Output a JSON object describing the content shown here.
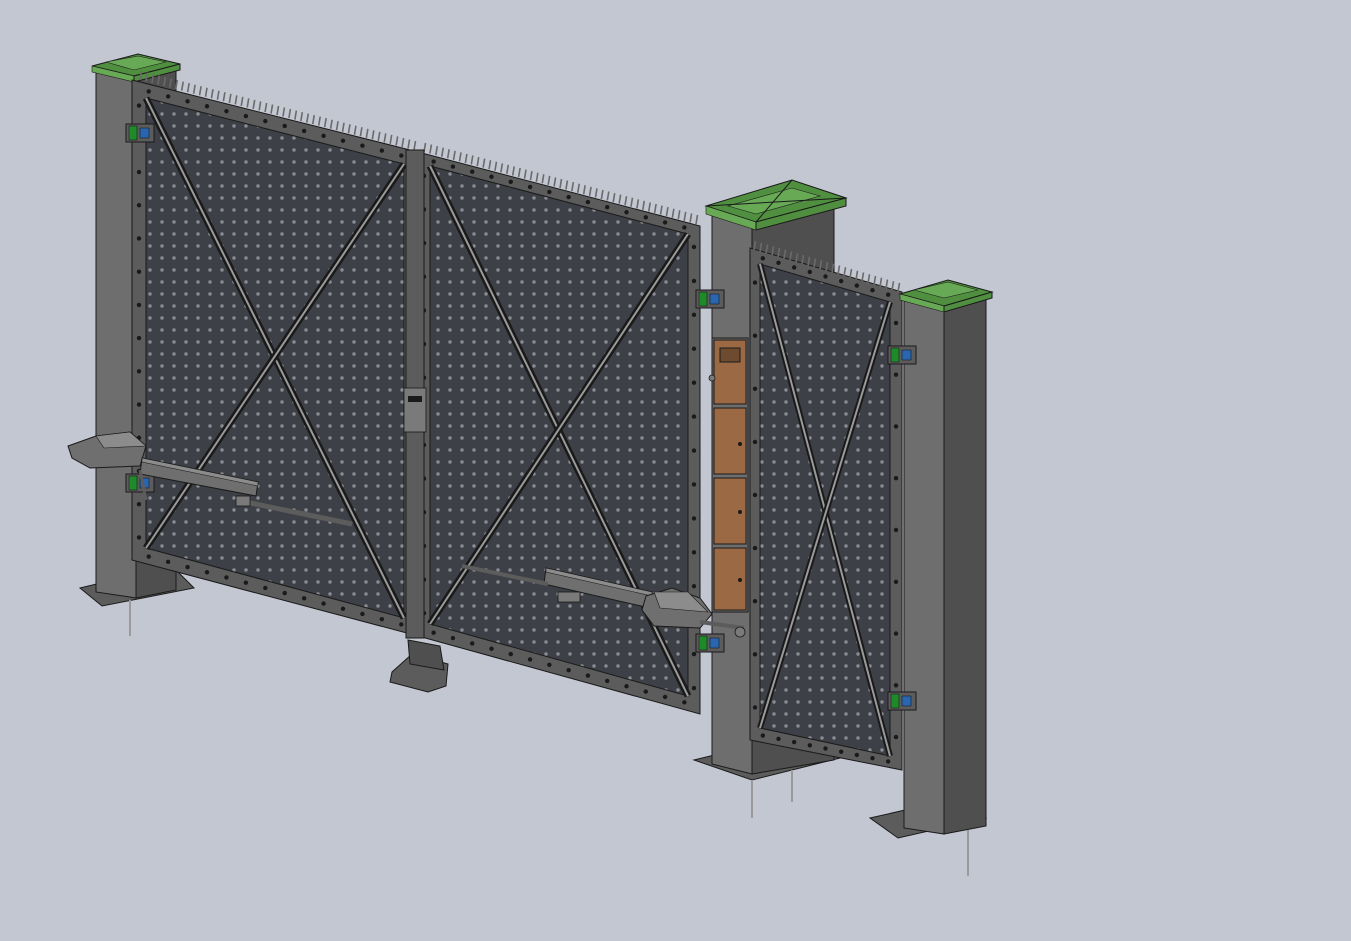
{
  "scene": {
    "subject": "",
    "colors": {
      "background": "#c3c7d2",
      "post_front": "#6e6e6e",
      "post_side": "#4f4f4f",
      "post_top": "#5a5a5a",
      "cap": "#4f8f3f",
      "cap_light": "#68a955",
      "frame": "#5c5c5c",
      "frame_light": "#7a7a7a",
      "mesh": "#3d4046",
      "mesh_dot": "#8a8d94",
      "brace": "#6a6a6a",
      "brace_light": "#9a9a9a",
      "spike": "#6a6a6a",
      "mailbox": "#9b6a44",
      "mailbox_dark": "#6e4a2e",
      "hinge_green": "#1e8a2a",
      "hinge_blue": "#2a66b0",
      "motor": "#6f6f6f",
      "motor_light": "#8c8c8c",
      "outline": "#1a1a1a"
    },
    "icons": [
      "gate-post",
      "post-cap",
      "gate-leaf",
      "wicket-gate",
      "mailbox",
      "gate-motor",
      "hinge",
      "anchor-bolt"
    ]
  }
}
